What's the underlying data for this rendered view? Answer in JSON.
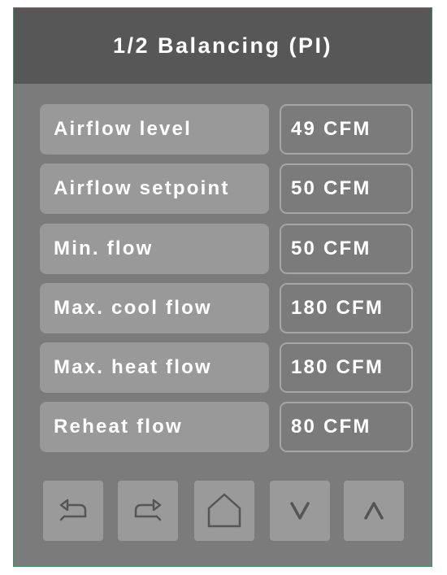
{
  "header": {
    "title": "1/2 Balancing (PI)"
  },
  "rows": [
    {
      "label": "Airflow level",
      "value": "49 CFM"
    },
    {
      "label": "Airflow setpoint",
      "value": "50 CFM"
    },
    {
      "label": "Min. flow",
      "value": "50 CFM"
    },
    {
      "label": "Max. cool flow",
      "value": "180 CFM"
    },
    {
      "label": "Max. heat flow",
      "value": "180 CFM"
    },
    {
      "label": "Reheat flow",
      "value": "80 CFM"
    }
  ],
  "nav": {
    "buttons": [
      {
        "icon": "undo-icon"
      },
      {
        "icon": "redo-icon"
      },
      {
        "icon": "home-icon"
      },
      {
        "icon": "chevron-down-icon"
      },
      {
        "icon": "chevron-up-icon"
      }
    ]
  },
  "colors": {
    "panel_background": "#7b7b7b",
    "header_background": "#575757",
    "label_box": "#999999",
    "value_box_border": "#a6a6a6",
    "nav_button": "#9a9a9a",
    "icon_stroke": "#555555",
    "text": "#ffffff",
    "frame_border": "#3f8f6a"
  }
}
